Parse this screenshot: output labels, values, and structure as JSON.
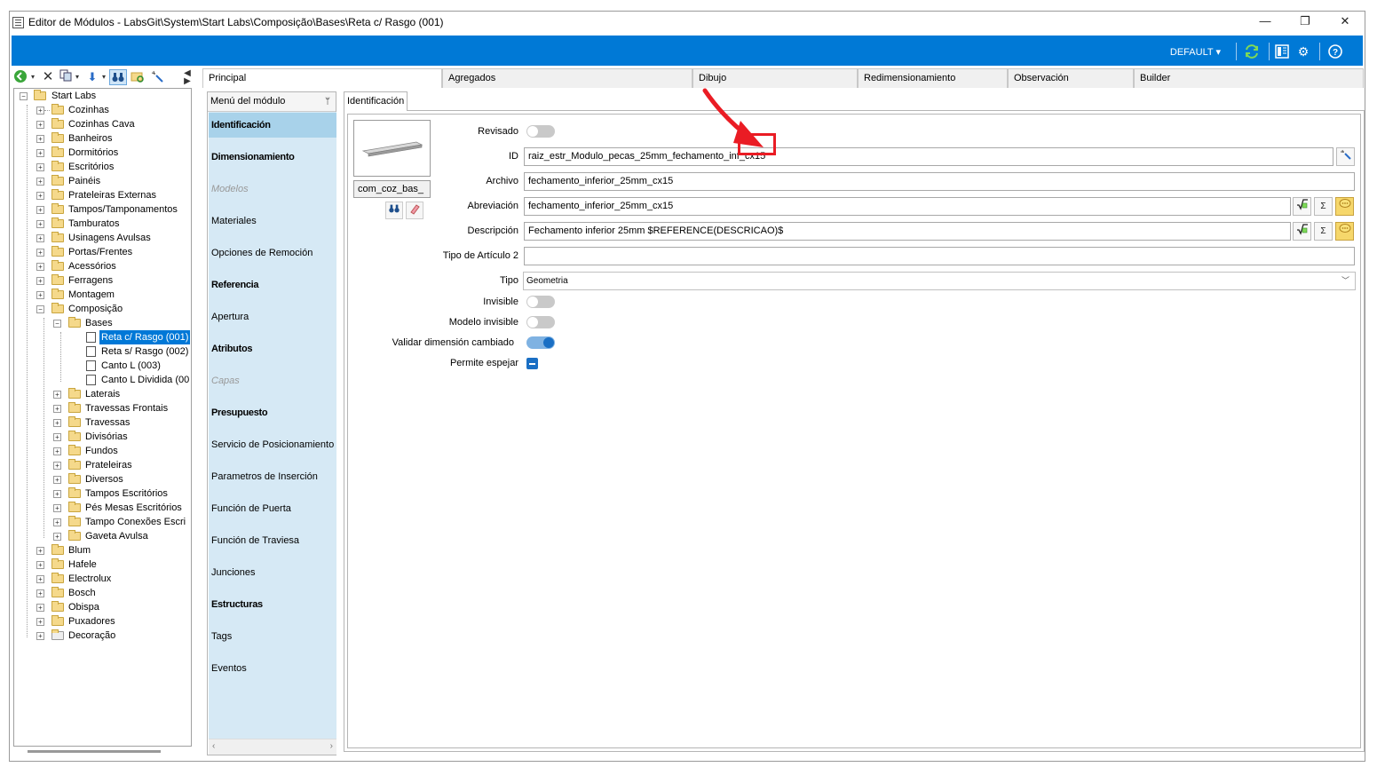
{
  "window": {
    "title": "Editor de Módulos - LabsGit\\System\\Start Labs\\Composição\\Bases\\Reta c/ Rasgo (001)",
    "minimize": "—",
    "maximize": "❐",
    "close": "✕"
  },
  "topbar": {
    "profile": "DEFAULT",
    "profile_arrow": "▾",
    "icons": [
      "refresh-icon",
      "layout-icon",
      "gears-icon",
      "help-icon"
    ],
    "accent": "#0079d6"
  },
  "tree": {
    "root": "Start Labs",
    "items": [
      "Cozinhas",
      "Cozinhas Cava",
      "Banheiros",
      "Dormitórios",
      "Escritórios",
      "Painéis",
      "Prateleiras Externas",
      "Tampos/Tamponamentos",
      "Tamburatos",
      "Usinagens Avulsas",
      "Portas/Frentes",
      "Acessórios",
      "Ferragens",
      "Montagem",
      "Composição"
    ],
    "composicao_children": {
      "bases": "Bases",
      "bases_children": [
        "Reta c/ Rasgo (001)",
        "Reta s/ Rasgo (002)",
        "Canto L (003)",
        "Canto L Dividida (00"
      ],
      "others": [
        "Laterais",
        "Travessas Frontais",
        "Travessas",
        "Divisórias",
        "Fundos",
        "Prateleiras",
        "Diversos",
        "Tampos Escritórios",
        "Pés Mesas Escritórios",
        "Tampo Conexões Escri",
        "Gaveta Avulsa"
      ]
    },
    "after": [
      "Blum",
      "Hafele",
      "Electrolux",
      "Bosch",
      "Obispa",
      "Puxadores",
      "Decoração"
    ]
  },
  "tabs": [
    "Principal",
    "Agregados",
    "Dibujo",
    "Redimensionamiento",
    "Observación",
    "Builder"
  ],
  "menu": {
    "header": "Menú del módulo",
    "pin": "ᛘ",
    "items": [
      {
        "label": "Identificación",
        "style": "bold active"
      },
      {
        "label": "Dimensionamiento",
        "style": "bold"
      },
      {
        "label": "Modelos",
        "style": "disabled"
      },
      {
        "label": "Materiales",
        "style": ""
      },
      {
        "label": "Opciones de Remoción",
        "style": ""
      },
      {
        "label": "Referencia",
        "style": "bold"
      },
      {
        "label": "Apertura",
        "style": ""
      },
      {
        "label": "Atributos",
        "style": "bold"
      },
      {
        "label": "Capas",
        "style": "disabled"
      },
      {
        "label": "Presupuesto",
        "style": "bold"
      },
      {
        "label": "Servicio de Posicionamiento",
        "style": ""
      },
      {
        "label": "Parametros de Inserción",
        "style": ""
      },
      {
        "label": "Función de Puerta",
        "style": ""
      },
      {
        "label": "Función de Traviesa",
        "style": ""
      },
      {
        "label": "Junciones",
        "style": ""
      },
      {
        "label": "Estructuras",
        "style": "bold"
      },
      {
        "label": "Tags",
        "style": ""
      },
      {
        "label": "Eventos",
        "style": ""
      }
    ]
  },
  "form": {
    "subtab": "Identificación",
    "thumb_label": "com_coz_bas_",
    "revisado_label": "Revisado",
    "id_label": "ID",
    "id_value": "raiz_estr_Modulo_pecas_25mm_fechamento_inf_cx15",
    "archivo_label": "Archivo",
    "archivo_value": "fechamento_inferior_25mm_cx15",
    "abreviacion_label": "Abreviación",
    "abreviacion_value": "fechamento_inferior_25mm_cx15",
    "descripcion_label": "Descripción",
    "descripcion_value": "Fechamento inferior 25mm $REFERENCE(DESCRICAO)$",
    "tipo_articulo_label": "Tipo de Artículo 2",
    "tipo_articulo_value": "",
    "tipo_label": "Tipo",
    "tipo_value": "Geometria",
    "invisible_label": "Invisible",
    "modelo_invisible_label": "Modelo invisible",
    "validar_label": "Validar dimensión cambiado",
    "permite_label": "Permite espejar",
    "sigma": "Σ",
    "toggles": {
      "revisado": false,
      "invisible": false,
      "modelo_invisible": false,
      "validar": true,
      "permite": true
    }
  }
}
